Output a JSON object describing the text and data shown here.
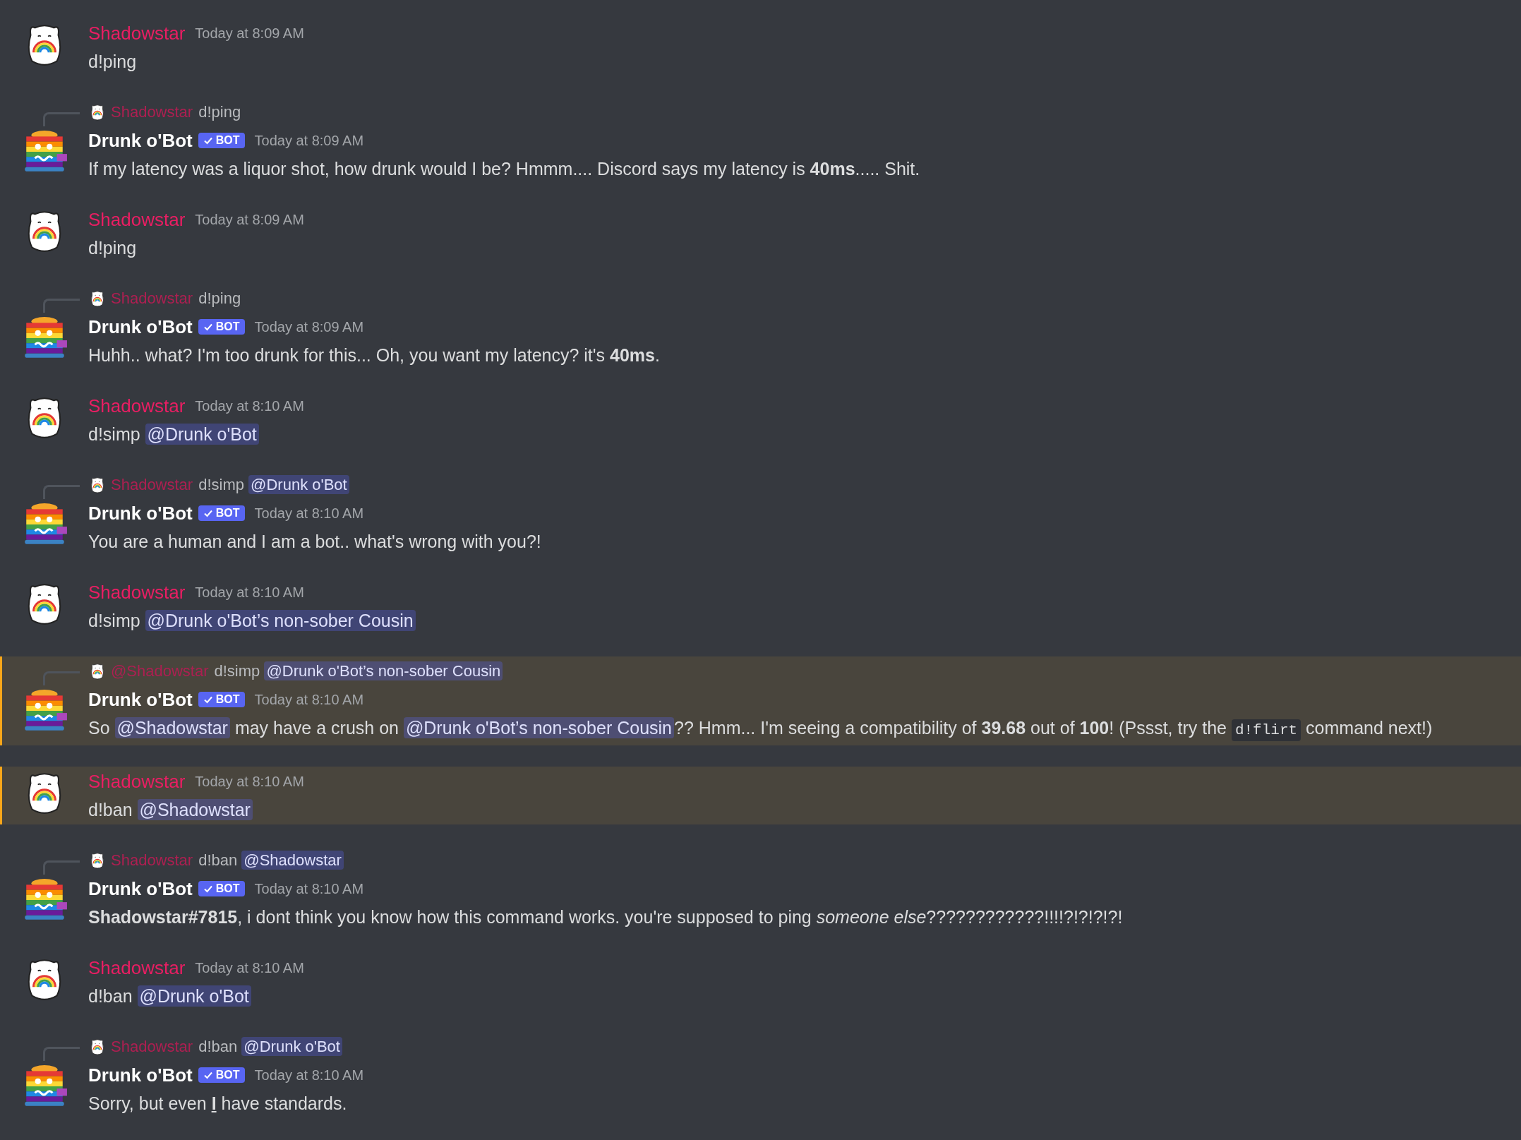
{
  "messages": [
    {
      "kind": "user",
      "author": "Shadowstar",
      "timestamp": "Today at 8:09 AM",
      "highlighted": false,
      "segments": [
        {
          "kind": "text",
          "text": "d!ping"
        }
      ]
    },
    {
      "kind": "bot",
      "author": "Drunk o'Bot",
      "badge": "BOT",
      "timestamp": "Today at 8:09 AM",
      "highlighted": false,
      "reply": {
        "author": "Shadowstar",
        "segments": [
          {
            "kind": "text",
            "text": "d!ping"
          }
        ]
      },
      "segments": [
        {
          "kind": "text",
          "text": "If my latency was a liquor shot, how drunk would I be? Hmmm.... Discord says my latency is **40ms**..... Shit."
        }
      ]
    },
    {
      "kind": "user",
      "author": "Shadowstar",
      "timestamp": "Today at 8:09 AM",
      "highlighted": false,
      "segments": [
        {
          "kind": "text",
          "text": "d!ping"
        }
      ]
    },
    {
      "kind": "bot",
      "author": "Drunk o'Bot",
      "badge": "BOT",
      "timestamp": "Today at 8:09 AM",
      "highlighted": false,
      "reply": {
        "author": "Shadowstar",
        "segments": [
          {
            "kind": "text",
            "text": "d!ping"
          }
        ]
      },
      "segments": [
        {
          "kind": "text",
          "text": "Huhh.. what? I'm too drunk for this... Oh, you want my latency? it's **40ms**."
        }
      ]
    },
    {
      "kind": "user",
      "author": "Shadowstar",
      "timestamp": "Today at 8:10 AM",
      "highlighted": false,
      "segments": [
        {
          "kind": "text",
          "text": "d!simp "
        },
        {
          "kind": "mention",
          "text": "@Drunk o'Bot"
        }
      ]
    },
    {
      "kind": "bot",
      "author": "Drunk o'Bot",
      "badge": "BOT",
      "timestamp": "Today at 8:10 AM",
      "highlighted": false,
      "reply": {
        "author": "Shadowstar",
        "segments": [
          {
            "kind": "text",
            "text": "d!simp "
          },
          {
            "kind": "mention",
            "text": "@Drunk o'Bot"
          }
        ]
      },
      "segments": [
        {
          "kind": "text",
          "text": "You are a human and I am a bot.. what's wrong with you?!"
        }
      ]
    },
    {
      "kind": "user",
      "author": "Shadowstar",
      "timestamp": "Today at 8:10 AM",
      "highlighted": false,
      "segments": [
        {
          "kind": "text",
          "text": "d!simp "
        },
        {
          "kind": "mention",
          "text": "@Drunk o'Bot’s non-sober Cousin"
        }
      ]
    },
    {
      "kind": "bot",
      "author": "Drunk o'Bot",
      "badge": "BOT",
      "timestamp": "Today at 8:10 AM",
      "highlighted": true,
      "reply": {
        "author": "@Shadowstar",
        "segments": [
          {
            "kind": "text",
            "text": "d!simp "
          },
          {
            "kind": "mention",
            "text": "@Drunk o'Bot’s non-sober Cousin"
          }
        ]
      },
      "segments": [
        {
          "kind": "text",
          "text": "So "
        },
        {
          "kind": "mention",
          "text": "@Shadowstar"
        },
        {
          "kind": "text",
          "text": " may have a crush on "
        },
        {
          "kind": "mention",
          "text": "@Drunk o'Bot’s non-sober Cousin"
        },
        {
          "kind": "text",
          "text": "?? Hmm... I'm seeing a compatibility of **39.68** out of **100**! (Pssst, try the "
        },
        {
          "kind": "code",
          "text": "d!flirt"
        },
        {
          "kind": "text",
          "text": " command next!)"
        }
      ]
    },
    {
      "kind": "user",
      "author": "Shadowstar",
      "timestamp": "Today at 8:10 AM",
      "highlighted": true,
      "segments": [
        {
          "kind": "text",
          "text": "d!ban "
        },
        {
          "kind": "mention",
          "text": "@Shadowstar"
        }
      ]
    },
    {
      "kind": "bot",
      "author": "Drunk o'Bot",
      "badge": "BOT",
      "timestamp": "Today at 8:10 AM",
      "highlighted": false,
      "reply": {
        "author": "Shadowstar",
        "segments": [
          {
            "kind": "text",
            "text": "d!ban "
          },
          {
            "kind": "mention",
            "text": "@Shadowstar"
          }
        ]
      },
      "segments": [
        {
          "kind": "text",
          "text": "**Shadowstar#7815**, i dont think you know how this command works. you're supposed to ping *someone else*????????????!!!!?!?!?!?!"
        }
      ]
    },
    {
      "kind": "user",
      "author": "Shadowstar",
      "timestamp": "Today at 8:10 AM",
      "highlighted": false,
      "segments": [
        {
          "kind": "text",
          "text": "d!ban "
        },
        {
          "kind": "mention",
          "text": "@Drunk o'Bot"
        }
      ]
    },
    {
      "kind": "bot",
      "author": "Drunk o'Bot",
      "badge": "BOT",
      "timestamp": "Today at 8:10 AM",
      "highlighted": false,
      "reply": {
        "author": "Shadowstar",
        "segments": [
          {
            "kind": "text",
            "text": "d!ban "
          },
          {
            "kind": "mention",
            "text": "@Drunk o'Bot"
          }
        ]
      },
      "segments": [
        {
          "kind": "text",
          "text": "Sorry, but even "
        },
        {
          "kind": "underline",
          "text": "I"
        },
        {
          "kind": "text",
          "text": " have standards."
        }
      ]
    }
  ]
}
